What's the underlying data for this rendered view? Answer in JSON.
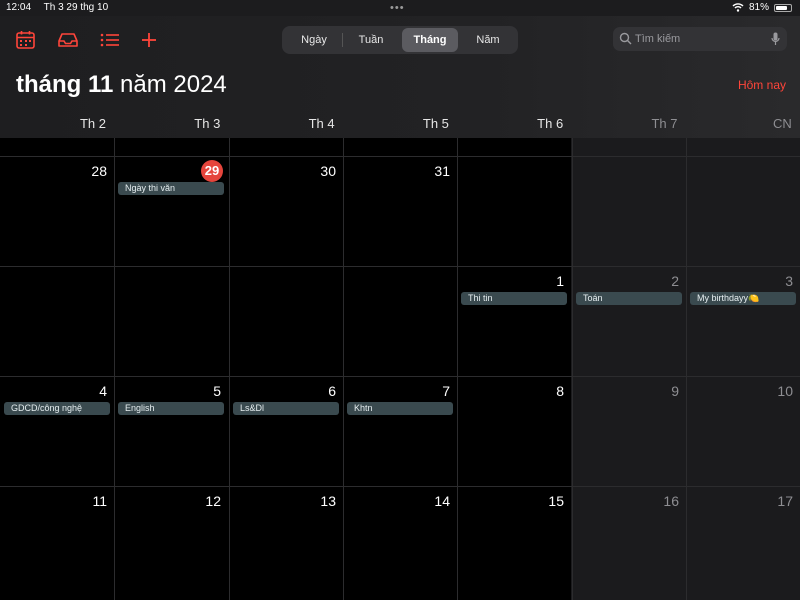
{
  "status": {
    "time": "12:04",
    "date": "Th 3 29 thg 10",
    "battery": "81%",
    "battery_level": 0.81
  },
  "toolbar": {
    "icons": [
      "calendar-icon",
      "inbox-icon",
      "list-icon",
      "add-icon"
    ],
    "views": [
      "Ngày",
      "Tuần",
      "Tháng",
      "Năm"
    ],
    "active_view": "Tháng",
    "search_placeholder": "Tìm kiếm"
  },
  "title": {
    "month": "tháng 11",
    "year": "năm 2024"
  },
  "today_label": "Hôm nay",
  "weekdays": [
    "Th 2",
    "Th 3",
    "Th 4",
    "Th 5",
    "Th 6",
    "Th 7",
    "CN"
  ],
  "weeks": [
    [
      {
        "day": "28"
      },
      {
        "day": "29",
        "today": true,
        "event": "Ngày thi văn"
      },
      {
        "day": "30"
      },
      {
        "day": "31"
      },
      {
        "day": ""
      },
      {
        "day": ""
      },
      {
        "day": ""
      }
    ],
    [
      {
        "day": ""
      },
      {
        "day": ""
      },
      {
        "day": ""
      },
      {
        "day": ""
      },
      {
        "day": "1",
        "event": "Thi tin"
      },
      {
        "day": "2",
        "event": "Toán"
      },
      {
        "day": "3",
        "event": "My birthdayy🍋"
      }
    ],
    [
      {
        "day": "4",
        "event": "GDCD/công nghệ"
      },
      {
        "day": "5",
        "event": "English"
      },
      {
        "day": "6",
        "event": "Ls&Dl"
      },
      {
        "day": "7",
        "event": "Khtn"
      },
      {
        "day": "8"
      },
      {
        "day": "9"
      },
      {
        "day": "10"
      }
    ],
    [
      {
        "day": "11"
      },
      {
        "day": "12"
      },
      {
        "day": "13"
      },
      {
        "day": "14"
      },
      {
        "day": "15"
      },
      {
        "day": "16"
      },
      {
        "day": "17"
      }
    ]
  ],
  "colors": {
    "accent": "#ff453a",
    "event_bg": "#3a4a4f",
    "today": "#e5453c"
  }
}
